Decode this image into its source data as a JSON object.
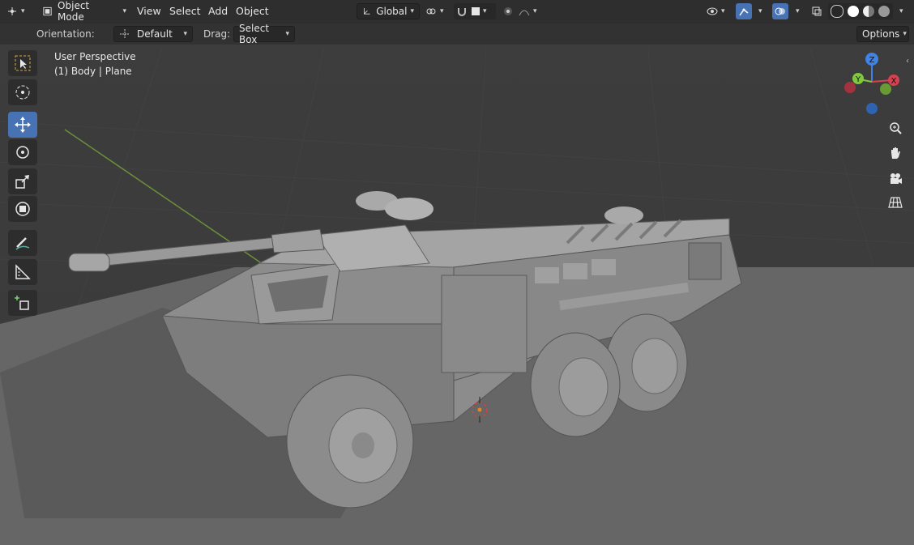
{
  "header": {
    "mode_label": "Object Mode",
    "menus": [
      "View",
      "Select",
      "Add",
      "Object"
    ],
    "transform_orientation": "Global",
    "options_label": "Options"
  },
  "tool_settings": {
    "orientation_label": "Orientation:",
    "orientation_value": "Default",
    "drag_label": "Drag:",
    "drag_value": "Select Box"
  },
  "viewport": {
    "view_name": "User Perspective",
    "object_info": "(1) Body | Plane"
  },
  "gizmo": {
    "x": "X",
    "y": "Y",
    "z": "Z"
  },
  "toolbar": {
    "tools": [
      "select-box",
      "cursor",
      "move",
      "rotate",
      "scale",
      "transform",
      "annotate",
      "measure",
      "add-cube"
    ],
    "active": "move"
  },
  "colors": {
    "accent": "#4772b3",
    "x_axis": "#d9404f",
    "y_axis": "#80c83c",
    "z_axis": "#3f83e6"
  }
}
